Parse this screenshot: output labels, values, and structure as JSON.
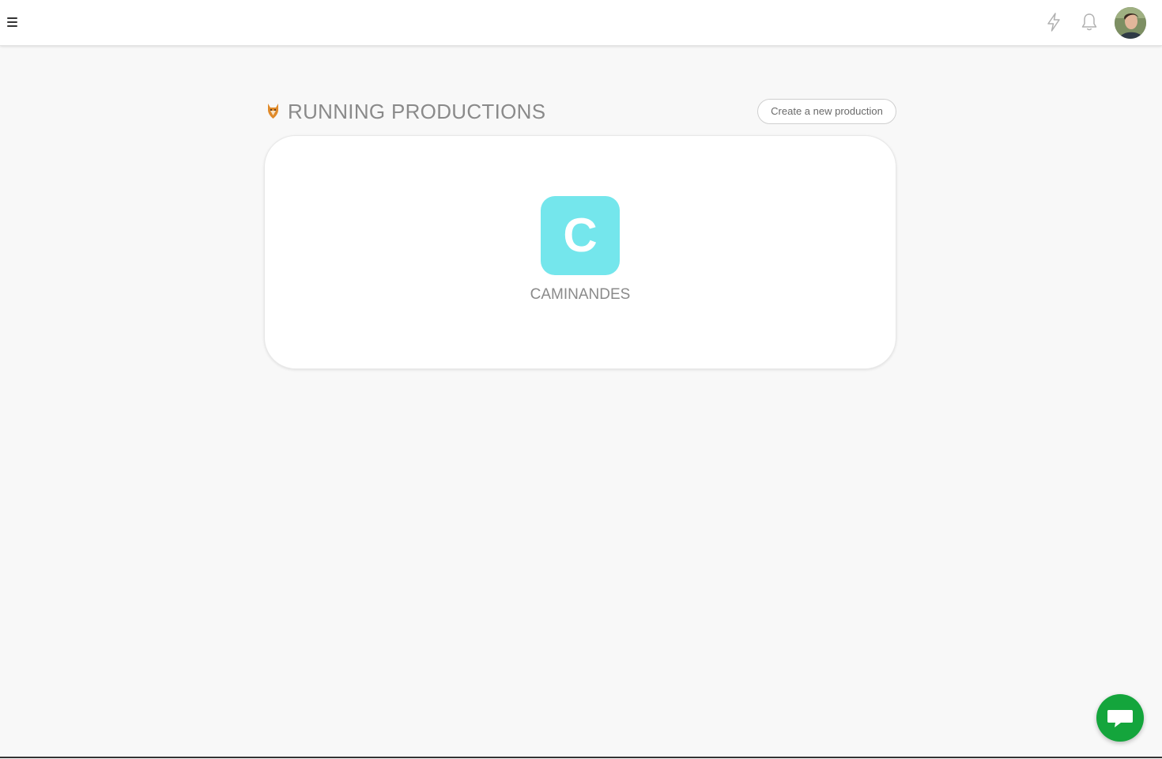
{
  "header": {
    "menu_icon": "hamburger-icon",
    "activity_icon": "lightning-icon",
    "notifications_icon": "bell-icon",
    "avatar_icon": "user-avatar"
  },
  "main": {
    "section_icon": "fox-icon",
    "title": "RUNNING PRODUCTIONS",
    "create_button_label": "Create a new production",
    "productions": [
      {
        "letter": "C",
        "name": "CAMINANDES",
        "color": "#74e6ec"
      }
    ]
  },
  "chat": {
    "icon": "chat-bubble-icon",
    "color": "#14a53c"
  }
}
